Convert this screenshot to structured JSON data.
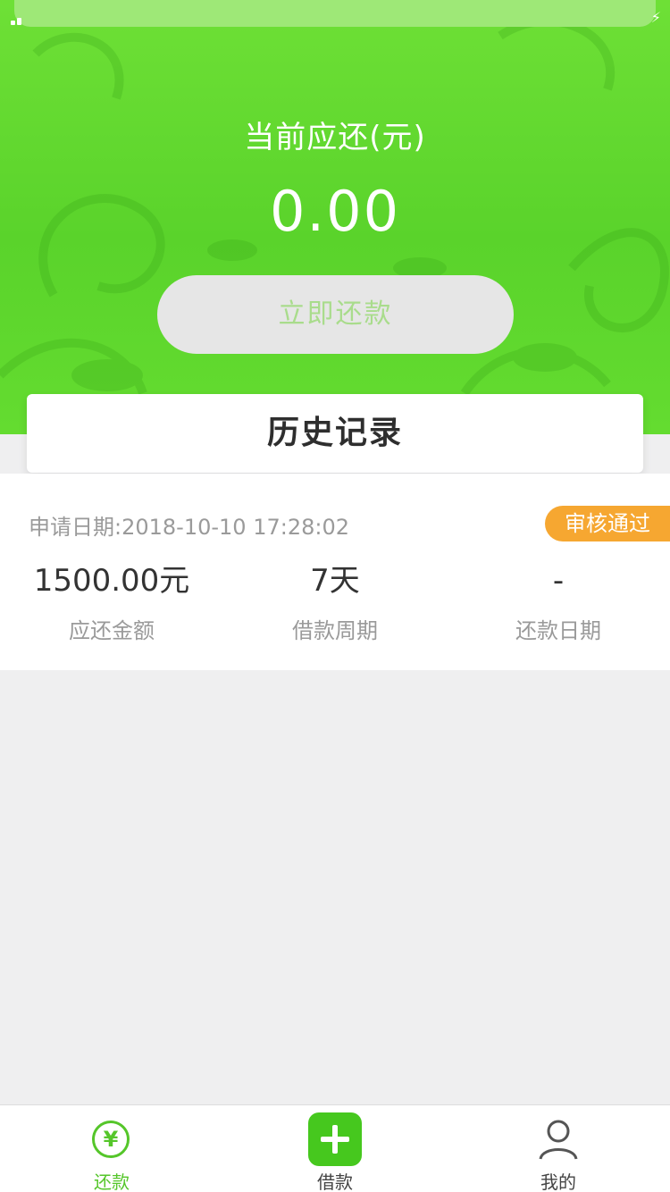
{
  "header": {
    "amount_label": "当前应还(元)",
    "amount_value": "0.00",
    "repay_button": "立即还款"
  },
  "history": {
    "title": "历史记录"
  },
  "record": {
    "date_text": "申请日期:2018-10-10 17:28:02",
    "status": "审核通过",
    "columns": [
      {
        "value": "1500.00元",
        "label": "应还金额"
      },
      {
        "value": "7天",
        "label": "借款周期"
      },
      {
        "value": "-",
        "label": "还款日期"
      }
    ]
  },
  "tabbar": {
    "items": [
      {
        "label": "还款",
        "icon": "yen-circle-icon",
        "active": true
      },
      {
        "label": "借款",
        "icon": "plus-icon",
        "active": false
      },
      {
        "label": "我的",
        "icon": "user-icon",
        "active": false
      }
    ]
  },
  "colors": {
    "brand_green": "#5ad32b",
    "status_orange": "#f6a731",
    "tab_active": "#55c62a"
  }
}
